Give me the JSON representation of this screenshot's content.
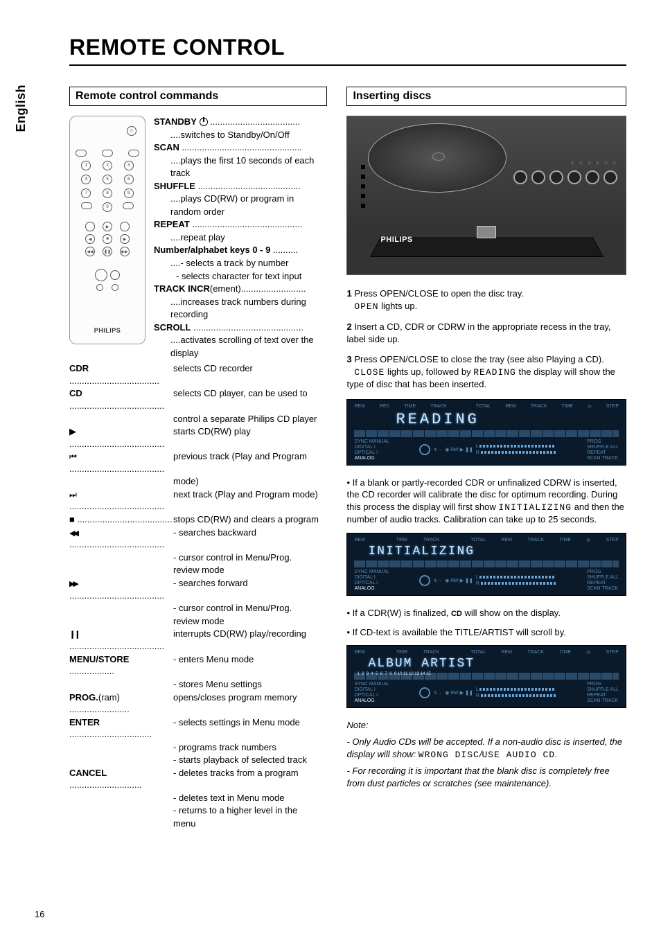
{
  "page": {
    "title": "REMOTE CONTROL",
    "side_tab": "English",
    "number": "16"
  },
  "left": {
    "header": "Remote control commands",
    "remote_brand": "PHILIPS",
    "upper_cmds": {
      "standby_label": "STANDBY",
      "standby_desc": "....switches to Standby/On/Off",
      "scan_label": "SCAN",
      "scan_dots": "................................................",
      "scan_desc": "....plays the first 10 seconds of each",
      "scan_desc2": "track",
      "shuffle_label": "SHUFFLE",
      "shuffle_dots": ".........................................",
      "shuffle_desc": "....plays CD(RW) or program in",
      "shuffle_desc2": "random order",
      "repeat_label": "REPEAT",
      "repeat_dots": "............................................",
      "repeat_desc": "....repeat play",
      "numkeys_label": "Number/alphabet keys 0 - 9",
      "numkeys_dots": "..........",
      "numkeys_desc": "....- selects a track by number",
      "numkeys_desc2": "- selects character for text input",
      "trackincr_label": "TRACK INCR",
      "trackincr_suffix": "(ement)",
      "trackincr_dots": "..........................",
      "trackincr_desc": "....increases track numbers during",
      "trackincr_desc2": "recording",
      "scroll_label": "SCROLL",
      "scroll_dots": "............................................",
      "scroll_desc": "....activates scrolling of text over the",
      "scroll_desc2": "display"
    },
    "lower_cmds": [
      {
        "label": "CDR",
        "dots": "....................................",
        "desc": "selects CD recorder"
      },
      {
        "label": "CD",
        "dots": "......................................",
        "desc": "selects CD player, can be used to"
      },
      {
        "label": "",
        "dots": "",
        "desc": "control a separate Philips CD player"
      },
      {
        "symbol": "play",
        "dots": "......................................",
        "desc": "starts CD(RW) play"
      },
      {
        "symbol": "prev",
        "dots": "......................................",
        "desc": "previous track (Play and Program"
      },
      {
        "label": "",
        "dots": "",
        "desc": "mode)"
      },
      {
        "symbol": "next",
        "dots": "......................................",
        "desc": "next track (Play and Program mode)"
      },
      {
        "symbol": "stop",
        "dots": "......................................",
        "desc": "stops CD(RW) and clears a program"
      },
      {
        "symbol": "rew",
        "dots": "......................................",
        "desc": "- searches backward"
      },
      {
        "label": "",
        "dots": "",
        "desc": "- cursor control in Menu/Prog."
      },
      {
        "label": "",
        "dots": "",
        "desc": "  review mode"
      },
      {
        "symbol": "ff",
        "dots": "......................................",
        "desc": "- searches forward"
      },
      {
        "label": "",
        "dots": "",
        "desc": "- cursor control in Menu/Prog."
      },
      {
        "label": "",
        "dots": "",
        "desc": "  review mode"
      },
      {
        "symbol": "pause",
        "dots": "......................................",
        "desc": "interrupts CD(RW) play/recording"
      },
      {
        "label": "MENU/STORE",
        "dots": "..................",
        "desc": "- enters Menu mode"
      },
      {
        "label": "",
        "dots": "",
        "desc": "- stores Menu settings"
      },
      {
        "label": "PROG.",
        "suffix": "(ram)",
        "dots": "........................",
        "desc": "opens/closes program memory"
      },
      {
        "label": "ENTER",
        "dots": ".................................",
        "desc": "- selects settings in Menu mode"
      },
      {
        "label": "",
        "dots": "",
        "desc": "- programs track numbers"
      },
      {
        "label": "",
        "dots": "",
        "desc": "- starts playback of selected track"
      },
      {
        "label": "CANCEL",
        "dots": ".............................",
        "desc": "- deletes tracks from a program"
      },
      {
        "label": "",
        "dots": "",
        "desc": "- deletes text in Menu mode"
      },
      {
        "label": "",
        "dots": "",
        "desc": "- returns to a higher level in the"
      },
      {
        "label": "",
        "dots": "",
        "desc": "  menu"
      }
    ]
  },
  "right": {
    "header": "Inserting discs",
    "device_brand": "PHILIPS",
    "steps": {
      "s1_num": "1",
      "s1": "Press OPEN/CLOSE to open the disc tray.",
      "s1b_pre": "",
      "s1b_lcd": "OPEN",
      "s1b_post": " lights up.",
      "s2_num": "2",
      "s2": "Insert a CD, CDR or CDRW in the appropriate recess in the tray, label side up.",
      "s3_num": "3",
      "s3": "Press OPEN/CLOSE to close the tray (see also Playing a CD).",
      "s3b_lcd1": "CLOSE",
      "s3b_mid": " lights up, followed by ",
      "s3b_lcd2": "READING",
      "s3b_post": " the display will show the type of disc that has been inserted."
    },
    "display1_big": "READING",
    "bullet1": "If a blank or partly-recorded CDR or unfinalized CDRW is inserted, the CD recorder will calibrate the disc for optimum recording. During this process the display will first show ",
    "bullet1_lcd": "INITIALIZING",
    "bullet1_post": " and then the number of audio tracks. Calibration can take up to 25 seconds.",
    "display2_big": "INITIALIZING",
    "bullet2_pre": "If a CDR(W) is finalized, ",
    "bullet2_cd": "CD",
    "bullet2_post": " will show on the display.",
    "bullet3": "If CD-text is available the TITLE/ARTIST will scroll by.",
    "display3_big": "ALBUM ARTIST",
    "note_title": "Note:",
    "note1_pre": "- Only Audio CDs will be accepted. If a non-audio disc is inserted, the display will show: ",
    "note1_lcd1": "WRONG DISC",
    "note1_mid": "/",
    "note1_lcd2": "USE AUDIO CD",
    "note1_post": ".",
    "note2": "- For recording it is important that the blank disc is completely free from dust particles or scratches (see maintenance).",
    "display_labels": {
      "top": [
        "REM",
        "REC",
        "TIME",
        "TRACK",
        "TOTAL",
        "REM",
        "TRACK",
        "TIME",
        "",
        "STEP"
      ],
      "sync": "SYNC  MANUAL",
      "inputs": [
        "DIGITAL I",
        "OPTICAL I",
        "ANALOG"
      ],
      "rw": "RW",
      "side": [
        "PROG",
        "SHUFFLE   ALL",
        "REPEAT",
        "SCAN   TRACK"
      ]
    }
  }
}
